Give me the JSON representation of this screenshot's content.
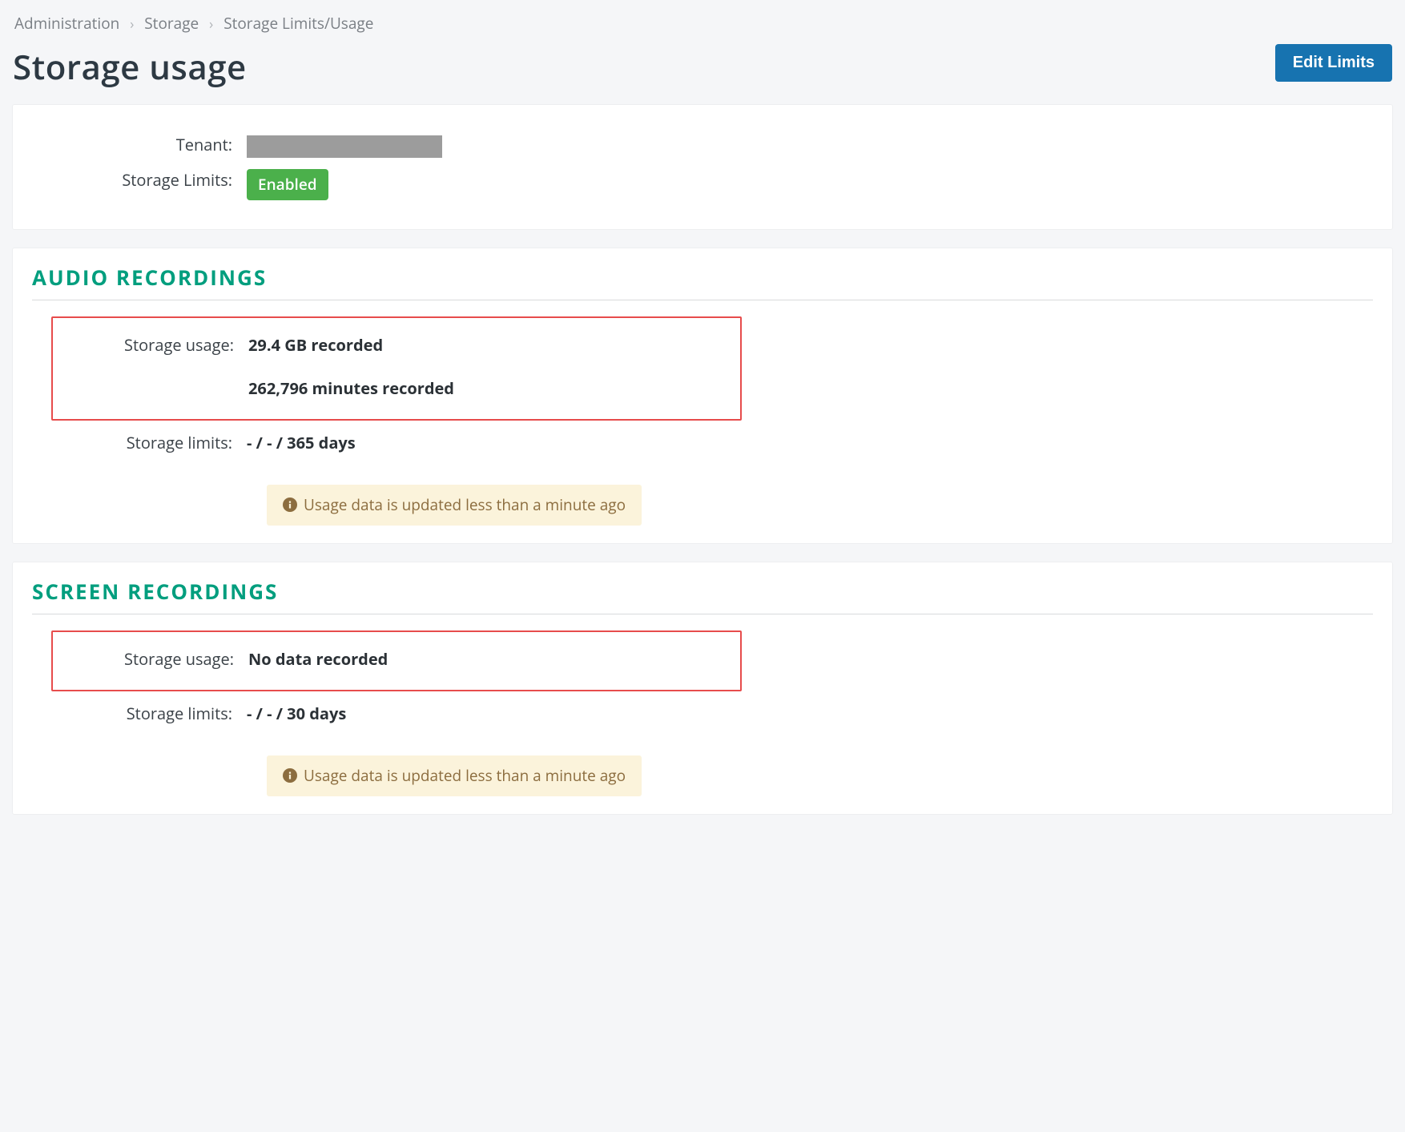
{
  "breadcrumb": {
    "a": "Administration",
    "b": "Storage",
    "c": "Storage Limits/Usage"
  },
  "page": {
    "title": "Storage usage",
    "edit_button": "Edit Limits"
  },
  "top": {
    "tenant_label": "Tenant:",
    "limits_label": "Storage Limits:",
    "enabled_badge": "Enabled"
  },
  "audio": {
    "title": "AUDIO  RECORDINGS",
    "usage_label": "Storage usage:",
    "usage_v1": "29.4 GB recorded",
    "usage_v2": "262,796 minutes recorded",
    "limits_label": "Storage limits:",
    "limits_value": "- / - / 365 days",
    "alert": "Usage data is updated less than a minute ago"
  },
  "screen": {
    "title": "SCREEN  RECORDINGS",
    "usage_label": "Storage usage:",
    "usage_v1": "No data recorded",
    "limits_label": "Storage limits:",
    "limits_value": "- / - / 30 days",
    "alert": "Usage data is updated less than a minute ago"
  }
}
